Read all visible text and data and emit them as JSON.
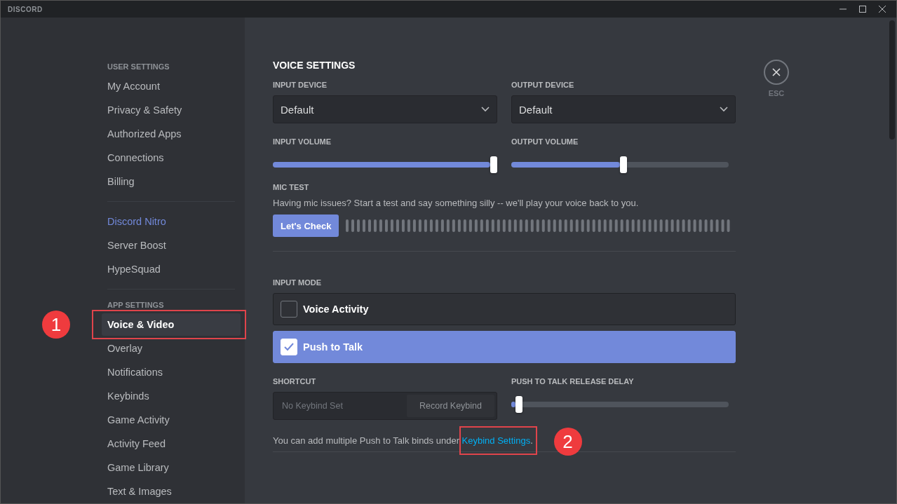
{
  "window": {
    "title": "DISCORD"
  },
  "sidebar": {
    "sections": [
      {
        "heading": "USER SETTINGS",
        "items": [
          {
            "label": "My Account",
            "kind": "item",
            "selected": false
          },
          {
            "label": "Privacy & Safety",
            "kind": "item",
            "selected": false
          },
          {
            "label": "Authorized Apps",
            "kind": "item",
            "selected": false
          },
          {
            "label": "Connections",
            "kind": "item",
            "selected": false
          },
          {
            "label": "Billing",
            "kind": "item",
            "selected": false
          }
        ]
      },
      {
        "items": [
          {
            "label": "Discord Nitro",
            "kind": "nitro",
            "selected": false
          },
          {
            "label": "Server Boost",
            "kind": "item",
            "selected": false
          },
          {
            "label": "HypeSquad",
            "kind": "item",
            "selected": false
          }
        ]
      },
      {
        "heading": "APP SETTINGS",
        "items": [
          {
            "label": "Voice & Video",
            "kind": "item",
            "selected": true,
            "annotation": "1"
          },
          {
            "label": "Overlay",
            "kind": "item",
            "selected": false
          },
          {
            "label": "Notifications",
            "kind": "item",
            "selected": false
          },
          {
            "label": "Keybinds",
            "kind": "item",
            "selected": false
          },
          {
            "label": "Game Activity",
            "kind": "item",
            "selected": false
          },
          {
            "label": "Activity Feed",
            "kind": "item",
            "selected": false
          },
          {
            "label": "Game Library",
            "kind": "item",
            "selected": false
          },
          {
            "label": "Text & Images",
            "kind": "item",
            "selected": false
          }
        ]
      }
    ]
  },
  "content": {
    "title": "VOICE SETTINGS",
    "devices": [
      {
        "label": "INPUT DEVICE",
        "value": "Default"
      },
      {
        "label": "OUTPUT DEVICE",
        "value": "Default"
      }
    ],
    "volumes": [
      {
        "label": "INPUT VOLUME",
        "level": 1.0
      },
      {
        "label": "OUTPUT VOLUME",
        "level": 0.5
      }
    ],
    "mic_test": {
      "label": "MIC TEST",
      "description": "Having mic issues? Start a test and say something silly -- we'll play your voice back to you.",
      "button": "Let's Check"
    },
    "input_mode": {
      "label": "INPUT MODE",
      "options": [
        {
          "label": "Voice Activity",
          "selected": false
        },
        {
          "label": "Push to Talk",
          "selected": true
        }
      ]
    },
    "shortcut": {
      "label": "SHORTCUT",
      "placeholder": "No Keybind Set",
      "button": "Record Keybind"
    },
    "release_delay": {
      "label": "PUSH TO TALK RELEASE DELAY",
      "level": 0.02
    },
    "hint": {
      "text": "You can add multiple Push to Talk binds under ",
      "link": "Keybind Settings",
      "after": ".",
      "annotation": "2"
    }
  },
  "close": {
    "label": "ESC"
  }
}
